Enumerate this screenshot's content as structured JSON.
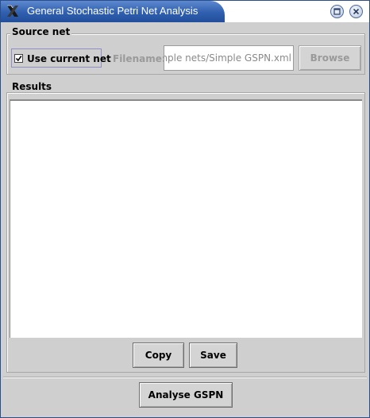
{
  "window": {
    "title": "General Stochastic Petri Net Analysis",
    "buttons": {
      "maximize": "maximize-icon",
      "close": "close-icon"
    }
  },
  "source": {
    "legend": "Source net",
    "use_current_label": "Use current net",
    "use_current_checked": true,
    "filename_label": "Filename:",
    "filename_value": "mple nets/Simple GSPN.xml",
    "browse_label": "Browse"
  },
  "results": {
    "legend": "Results",
    "content": "",
    "copy_label": "Copy",
    "save_label": "Save"
  },
  "footer": {
    "analyse_label": "Analyse GSPN"
  },
  "colors": {
    "title_bar": "#2f5fae",
    "window_bg": "#cfcfcf",
    "disabled_text": "#9a9a9a"
  }
}
